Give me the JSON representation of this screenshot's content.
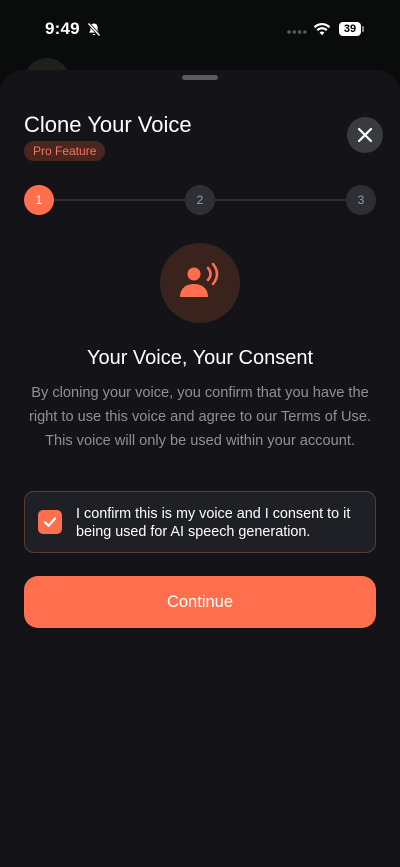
{
  "status_bar": {
    "time": "9:49",
    "battery": "39",
    "icons": [
      "bell-slash-icon",
      "signal-icon",
      "wifi-icon",
      "battery-icon"
    ]
  },
  "sheet": {
    "title": "Clone Your Voice",
    "badge": "Pro Feature",
    "close_icon": "close-icon"
  },
  "stepper": {
    "steps": [
      "1",
      "2",
      "3"
    ],
    "current_step": 1
  },
  "hero": {
    "icon": "voice-speaking-icon",
    "heading": "Your Voice, Your Consent",
    "description": "By cloning your voice, you confirm that you have the right to use this voice and agree to our Terms of Use. This voice will only be used within your account."
  },
  "consent": {
    "checked": true,
    "text": "I confirm this is my voice and I consent to it being used for AI speech generation."
  },
  "actions": {
    "continue_label": "Continue"
  },
  "colors": {
    "accent": "#ff6f4e",
    "sheet_background": "#141418",
    "badge_background": "#4b2621",
    "badge_text": "#ef7a5c",
    "muted_text": "#8f9097"
  }
}
